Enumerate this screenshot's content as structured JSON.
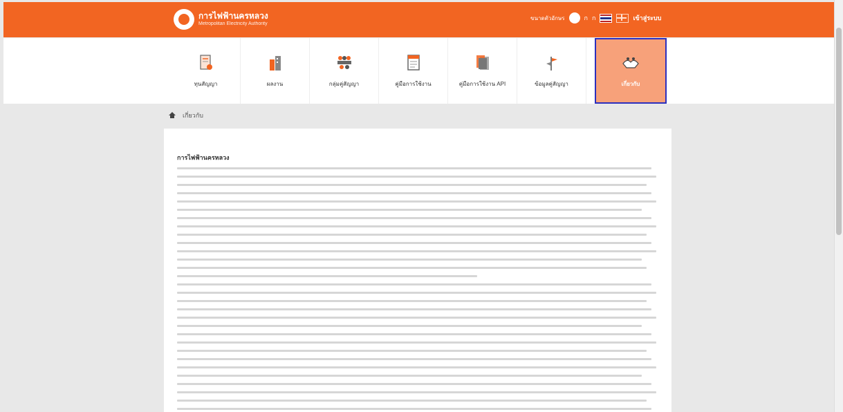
{
  "header": {
    "logo_title": "การไฟฟ้านครหลวง",
    "logo_subtitle": "Metropolitan Electricity Authority",
    "font_size_label": "ขนาดตัวอักษร",
    "font_small": "ก",
    "font_large": "ก",
    "login_label": "เข้าสู่ระบบ",
    "icons": [
      "logo-icon",
      "thai-flag-icon",
      "english-flag-icon"
    ]
  },
  "menu": {
    "items": [
      {
        "label": "ทุนสัญญา",
        "icon": "document-icon",
        "active": false
      },
      {
        "label": "ผลงาน",
        "icon": "building-icon",
        "active": false
      },
      {
        "label": "กลุ่มคู่สัญญา",
        "icon": "people-icon",
        "active": false
      },
      {
        "label": "คู่มือการใช้งาน",
        "icon": "manual-icon",
        "active": false
      },
      {
        "label": "คู่มือการใช้งาน API",
        "icon": "api-manual-icon",
        "active": false
      },
      {
        "label": "ข้อมูลคู่สัญญา",
        "icon": "signpost-icon",
        "active": false
      },
      {
        "label": "เกี่ยวกับ",
        "icon": "handshake-icon",
        "active": true
      }
    ]
  },
  "breadcrumb": {
    "home_icon": "home-icon",
    "current": "เกี่ยวกับ"
  },
  "content": {
    "title": "การไฟฟ้านครหลวง"
  },
  "colors": {
    "brand": "#f26522",
    "active_tab": "#f7a17a",
    "active_border": "#2a2fbf"
  }
}
